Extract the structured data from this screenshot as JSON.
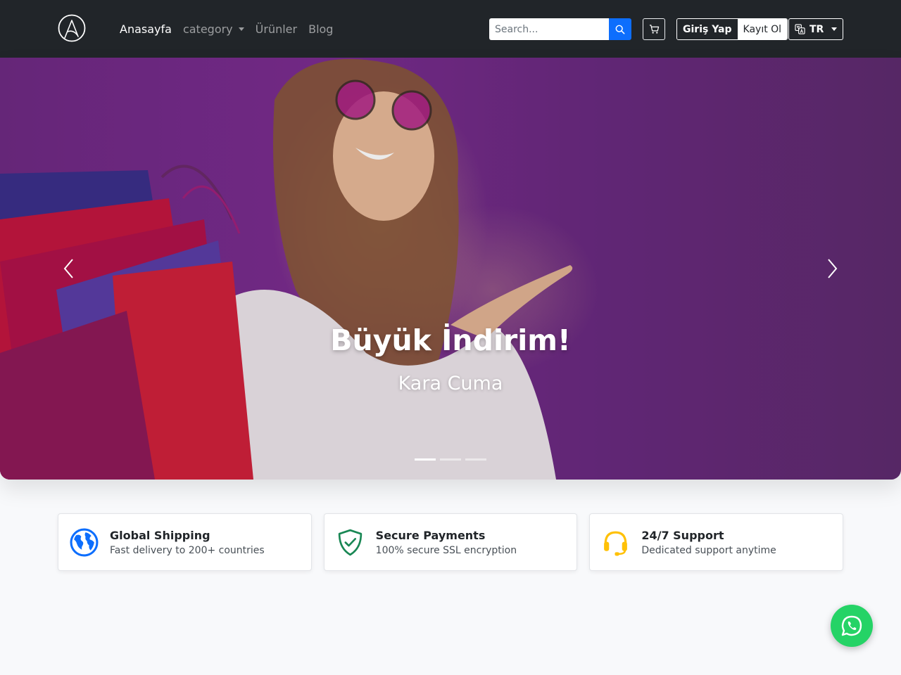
{
  "nav": {
    "links": [
      {
        "label": "Anasayfa",
        "active": true
      },
      {
        "label": "category",
        "dropdown": true
      },
      {
        "label": "Ürünler"
      },
      {
        "label": "Blog"
      }
    ],
    "search": {
      "placeholder": "Search...",
      "value": ""
    },
    "auth": {
      "login_label": "Giriş Yap",
      "register_label": "Kayıt Ol"
    },
    "language": {
      "selected": "TR"
    }
  },
  "hero": {
    "title": "Büyük İndirim!",
    "subtitle": "Kara Cuma",
    "slide_count": 3,
    "active_slide": 1
  },
  "features": [
    {
      "title": "Global Shipping",
      "description": "Fast delivery to 200+ countries",
      "icon": "globe-icon",
      "color": "#0d6efd"
    },
    {
      "title": "Secure Payments",
      "description": "100% secure SSL encryption",
      "icon": "shield-check-icon",
      "color": "#198754"
    },
    {
      "title": "24/7 Support",
      "description": "Dedicated support anytime",
      "icon": "headset-icon",
      "color": "#ffc107"
    }
  ],
  "colors": {
    "navbar_bg": "#212529",
    "primary": "#0d6efd",
    "whatsapp": "#25d366"
  }
}
